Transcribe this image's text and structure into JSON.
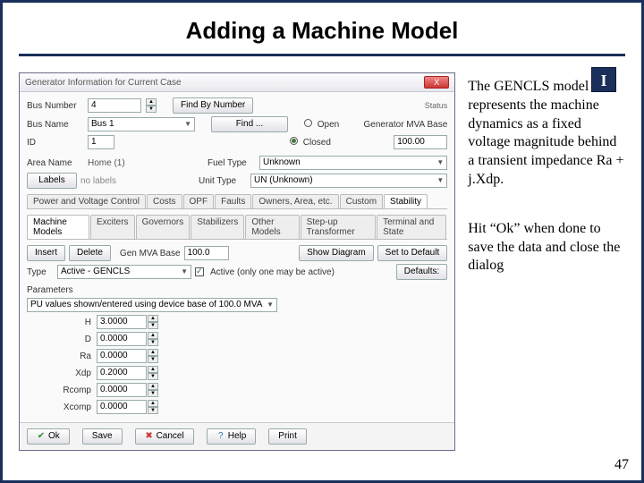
{
  "slide": {
    "title": "Adding a Machine Model",
    "logo": "I",
    "page": "47"
  },
  "sidetext": {
    "p1": "The GENCLS model represents the machine dynamics as a fixed voltage magnitude behind a transient impedance Ra + j.Xdp.",
    "p2": "Hit “Ok” when done to save the data and close the dialog"
  },
  "dialog": {
    "title": "Generator Information for Current Case",
    "close": "X",
    "busNumberLabel": "Bus Number",
    "busNumberValue": "4",
    "findByNumber": "Find By Number",
    "busNameLabel": "Bus Name",
    "busNameValue": "Bus 1",
    "findBtn": "Find ...",
    "idLabel": "ID",
    "idValue": "1",
    "statusLabel": "Status",
    "statusOpen": "Open",
    "statusClosed": "Closed",
    "mvaBaseLabel": "Generator MVA Base",
    "mvaBaseValue": "100.00",
    "areaNameLabel": "Area Name",
    "areaNameValue": "Home (1)",
    "fuelTypeLabel": "Fuel Type",
    "fuelTypeValue": "Unknown",
    "labelsBtn": "Labels ...",
    "labelsValue": "no labels",
    "unitTypeLabel": "Unit Type",
    "unitTypeValue": "UN (Unknown)",
    "tabs": [
      "Power and Voltage Control",
      "Costs",
      "OPF",
      "Faults",
      "Owners, Area, etc.",
      "Custom",
      "Stability"
    ],
    "activeTab": 6,
    "subtabs": [
      "Machine Models",
      "Exciters",
      "Governors",
      "Stabilizers",
      "Other Models",
      "Step-up Transformer",
      "Terminal and State"
    ],
    "activeSubtab": 0,
    "insertBtn": "Insert",
    "deleteBtn": "Delete",
    "genMvaBaseLabel": "Gen MVA Base",
    "genMvaBaseValue": "100.0",
    "showDiagram": "Show Diagram",
    "setDefault": "Set to Default",
    "typeLabel": "Type",
    "typeValue": "Active - GENCLS",
    "activeChkLabel": "Active (only one may be active)",
    "defaultsBtn": "Defaults:",
    "paramsTitle": "Parameters",
    "puNote": "PU values shown/entered using device base of 100.0 MVA",
    "params": [
      {
        "name": "H",
        "value": "3.0000"
      },
      {
        "name": "D",
        "value": "0.0000"
      },
      {
        "name": "Ra",
        "value": "0.0000"
      },
      {
        "name": "Xdp",
        "value": "0.2000"
      },
      {
        "name": "Rcomp",
        "value": "0.0000"
      },
      {
        "name": "Xcomp",
        "value": "0.0000"
      }
    ],
    "footer": {
      "ok": "Ok",
      "save": "Save",
      "cancel": "Cancel",
      "help": "Help",
      "print": "Print"
    }
  }
}
